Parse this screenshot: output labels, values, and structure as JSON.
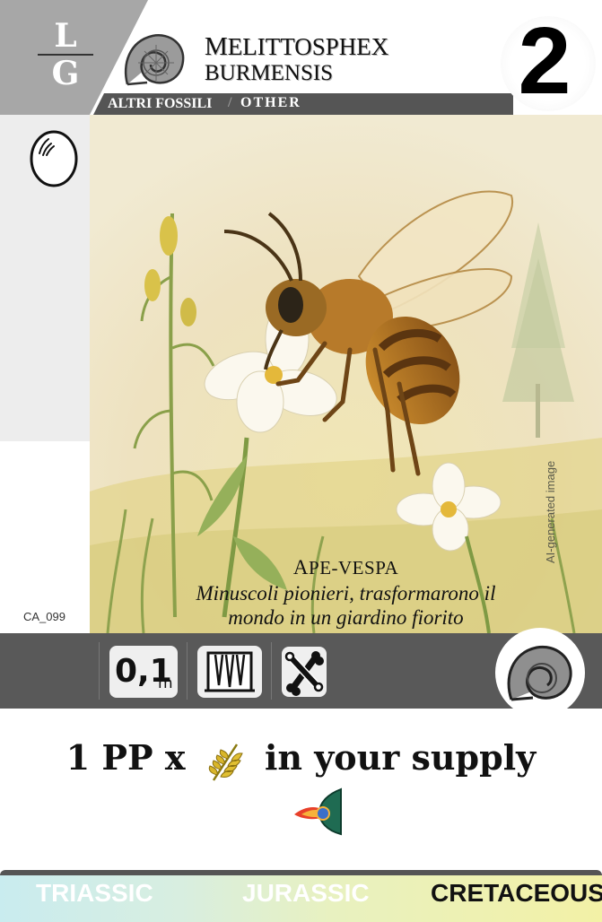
{
  "card": {
    "generation_top": "L",
    "generation_bottom": "G",
    "title_line1_first": "M",
    "title_line1_rest": "ELITTOSPHEX",
    "title_line2": "BURMENSIS",
    "category_it": "ALTRI FOSSILI",
    "category_sep": "/",
    "category_en": "OTHER",
    "cost": "2",
    "card_code": "CA_099"
  },
  "art": {
    "ai_label": "AI-generated image",
    "common_name_first": "A",
    "common_name_rest": "PE-VESPA",
    "flavor_line1": "Minuscoli pionieri, trasformarono il",
    "flavor_line2": "mondo in un giardino fiorito"
  },
  "stats": {
    "size_value": "0,1",
    "size_unit": "m",
    "teeth_icon": "teeth-icon",
    "bones_icon": "bones-icon",
    "badge_icon": "ammonite-icon"
  },
  "ability": {
    "part1": "1 PP x",
    "part2": "in your supply",
    "icon1": "fern-leaf-icon",
    "icon2": "comet-icon"
  },
  "periods": {
    "triassic": "TRIASSIC",
    "jurassic": "JURASSIC",
    "cretaceous": "CRETACEOUS"
  },
  "colors": {
    "header_grey": "#a7a7a7",
    "category_bar": "#555555",
    "stats_bar": "#595959",
    "active_period": "#111111",
    "inactive_period": "#ffffff"
  }
}
